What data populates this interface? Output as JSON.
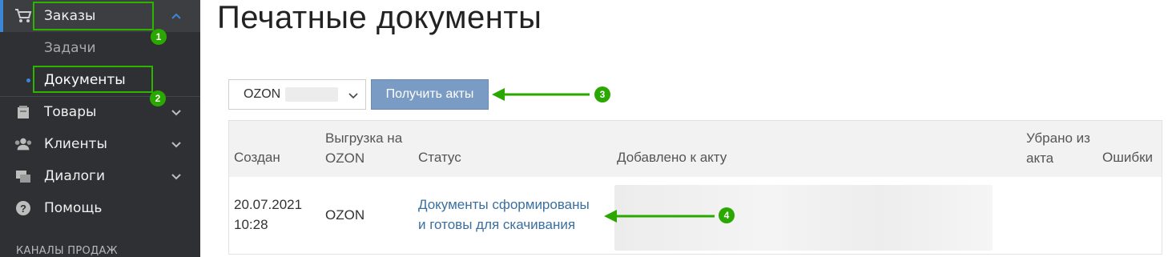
{
  "sidebar": {
    "items": [
      {
        "label": "Заказы",
        "icon": "cart-icon"
      },
      {
        "label": "Задачи"
      },
      {
        "label": "Документы"
      },
      {
        "label": "Товары",
        "icon": "box-icon"
      },
      {
        "label": "Клиенты",
        "icon": "users-icon"
      },
      {
        "label": "Диалоги",
        "icon": "chat-icon"
      },
      {
        "label": "Помощь",
        "icon": "help-icon"
      }
    ],
    "section_title": "КАНАЛЫ ПРОДАЖ"
  },
  "annotations": {
    "badge_1": "1",
    "badge_2": "2",
    "badge_3": "3",
    "badge_4": "4",
    "color": "#2aa800"
  },
  "main": {
    "title": "Печатные документы",
    "select_value": "OZON",
    "button_label": "Получить акты",
    "table": {
      "headers": {
        "created": "Создан",
        "export_line1": "Выгрузка на",
        "export_line2": "OZON",
        "status": "Статус",
        "added": "Добавлено к акту",
        "removed_line1": "Убрано из",
        "removed_line2": "акта",
        "errors": "Ошибки"
      },
      "rows": [
        {
          "created_date": "20.07.2021",
          "created_time": "10:28",
          "export": "OZON",
          "status_line1": "Документы сформированы",
          "status_line2": "и готовы для скачивания"
        }
      ]
    }
  },
  "colors": {
    "sidebar_bg": "#2f3034",
    "accent_blue": "#3b86d6",
    "button_bg": "#7a9cc4",
    "link": "#3a6f9f"
  }
}
